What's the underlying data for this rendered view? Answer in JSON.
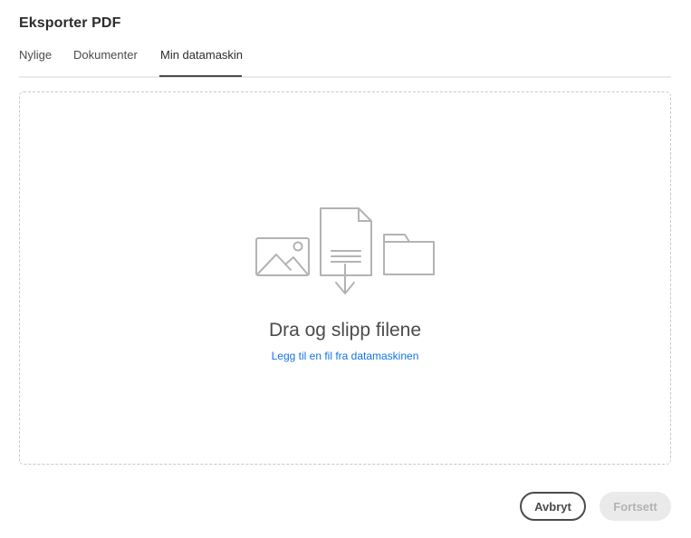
{
  "dialog": {
    "title": "Eksporter PDF"
  },
  "tabs": [
    {
      "label": "Nylige",
      "active": false
    },
    {
      "label": "Dokumenter",
      "active": false
    },
    {
      "label": "Min datamaskin",
      "active": true
    }
  ],
  "dropzone": {
    "title": "Dra og slipp filene",
    "link": "Legg til en fil fra datamaskinen",
    "icons": [
      "image-icon",
      "document-download-icon",
      "folder-icon"
    ]
  },
  "buttons": {
    "cancel": "Avbryt",
    "continue": "Fortsett"
  },
  "colors": {
    "link": "#1473e6",
    "icon_stroke": "#b3b3b3",
    "disabled_bg": "#eaeaea",
    "disabled_text": "#b3b3b3",
    "tab_underline": "#4b4b4b"
  }
}
